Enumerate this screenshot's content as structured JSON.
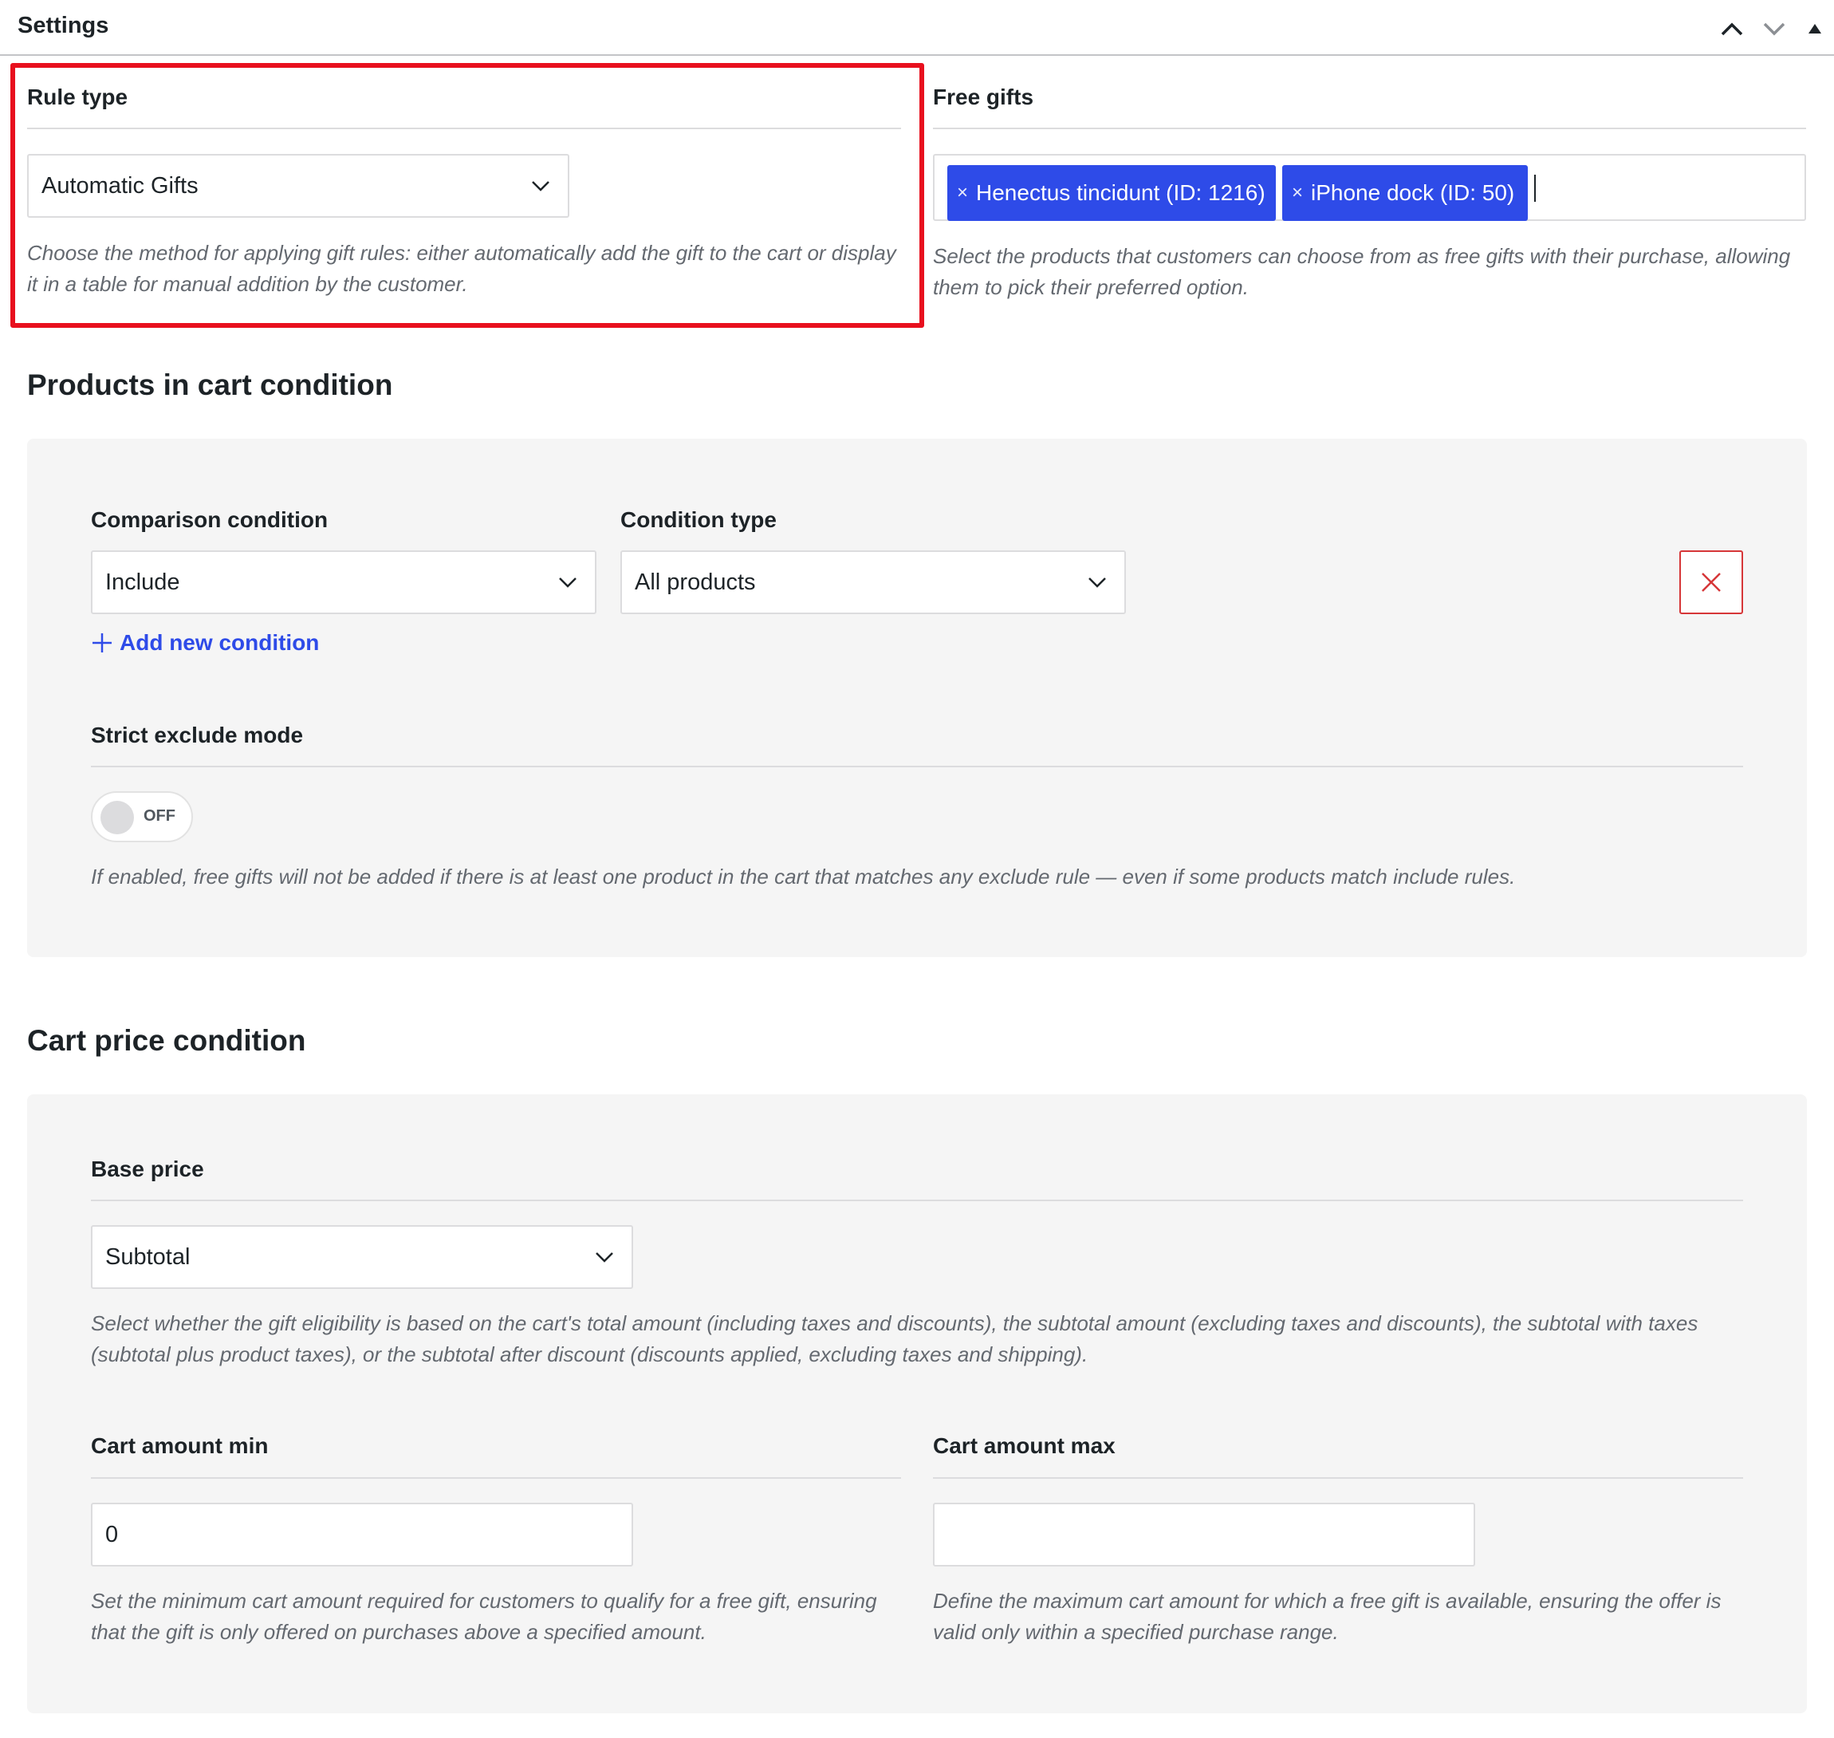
{
  "header": {
    "title": "Settings",
    "icons": [
      "chevron-up-icon",
      "chevron-down-icon",
      "triangle-up-icon"
    ]
  },
  "rule_type": {
    "label": "Rule type",
    "selected": "Automatic Gifts",
    "description": "Choose the method for applying gift rules: either automatically add the gift to the cart or display it in a table for manual addition by the customer."
  },
  "free_gifts": {
    "label": "Free gifts",
    "tags": [
      {
        "label": "Henectus tincidunt (ID: 1216)",
        "remove": "×"
      },
      {
        "label": "iPhone dock (ID: 50)",
        "remove": "×"
      }
    ],
    "description": "Select the products that customers can choose from as free gifts with their purchase, allowing them to pick their preferred option.",
    "tag_color": "#2e4be8"
  },
  "products_condition": {
    "title": "Products in cart condition",
    "comparison_label": "Comparison condition",
    "comparison_value": "Include",
    "condition_type_label": "Condition type",
    "condition_type_value": "All products",
    "add_condition": "Add new condition",
    "strict_label": "Strict exclude mode",
    "toggle_text": "OFF",
    "toggle_on": false,
    "strict_description": "If enabled, free gifts will not be added if there is at least one product in the cart that matches any exclude rule — even if some products match include rules."
  },
  "cart_price_condition": {
    "title": "Cart price condition",
    "base_price_label": "Base price",
    "base_price_value": "Subtotal",
    "base_price_description": "Select whether the gift eligibility is based on the cart's total amount (including taxes and discounts), the subtotal amount (excluding taxes and discounts), the subtotal with taxes (subtotal plus product taxes), or the subtotal after discount (discounts applied, excluding taxes and shipping).",
    "min_label": "Cart amount min",
    "min_value": "0",
    "min_description": "Set the minimum cart amount required for customers to qualify for a free gift, ensuring that the gift is only offered on purchases above a specified amount.",
    "max_label": "Cart amount max",
    "max_value": "",
    "max_description": "Define the maximum cart amount for which a free gift is available, ensuring the offer is valid only within a specified purchase range."
  },
  "colors": {
    "highlight": "#e8101e",
    "link": "#2e4be8",
    "danger": "#d63638"
  }
}
